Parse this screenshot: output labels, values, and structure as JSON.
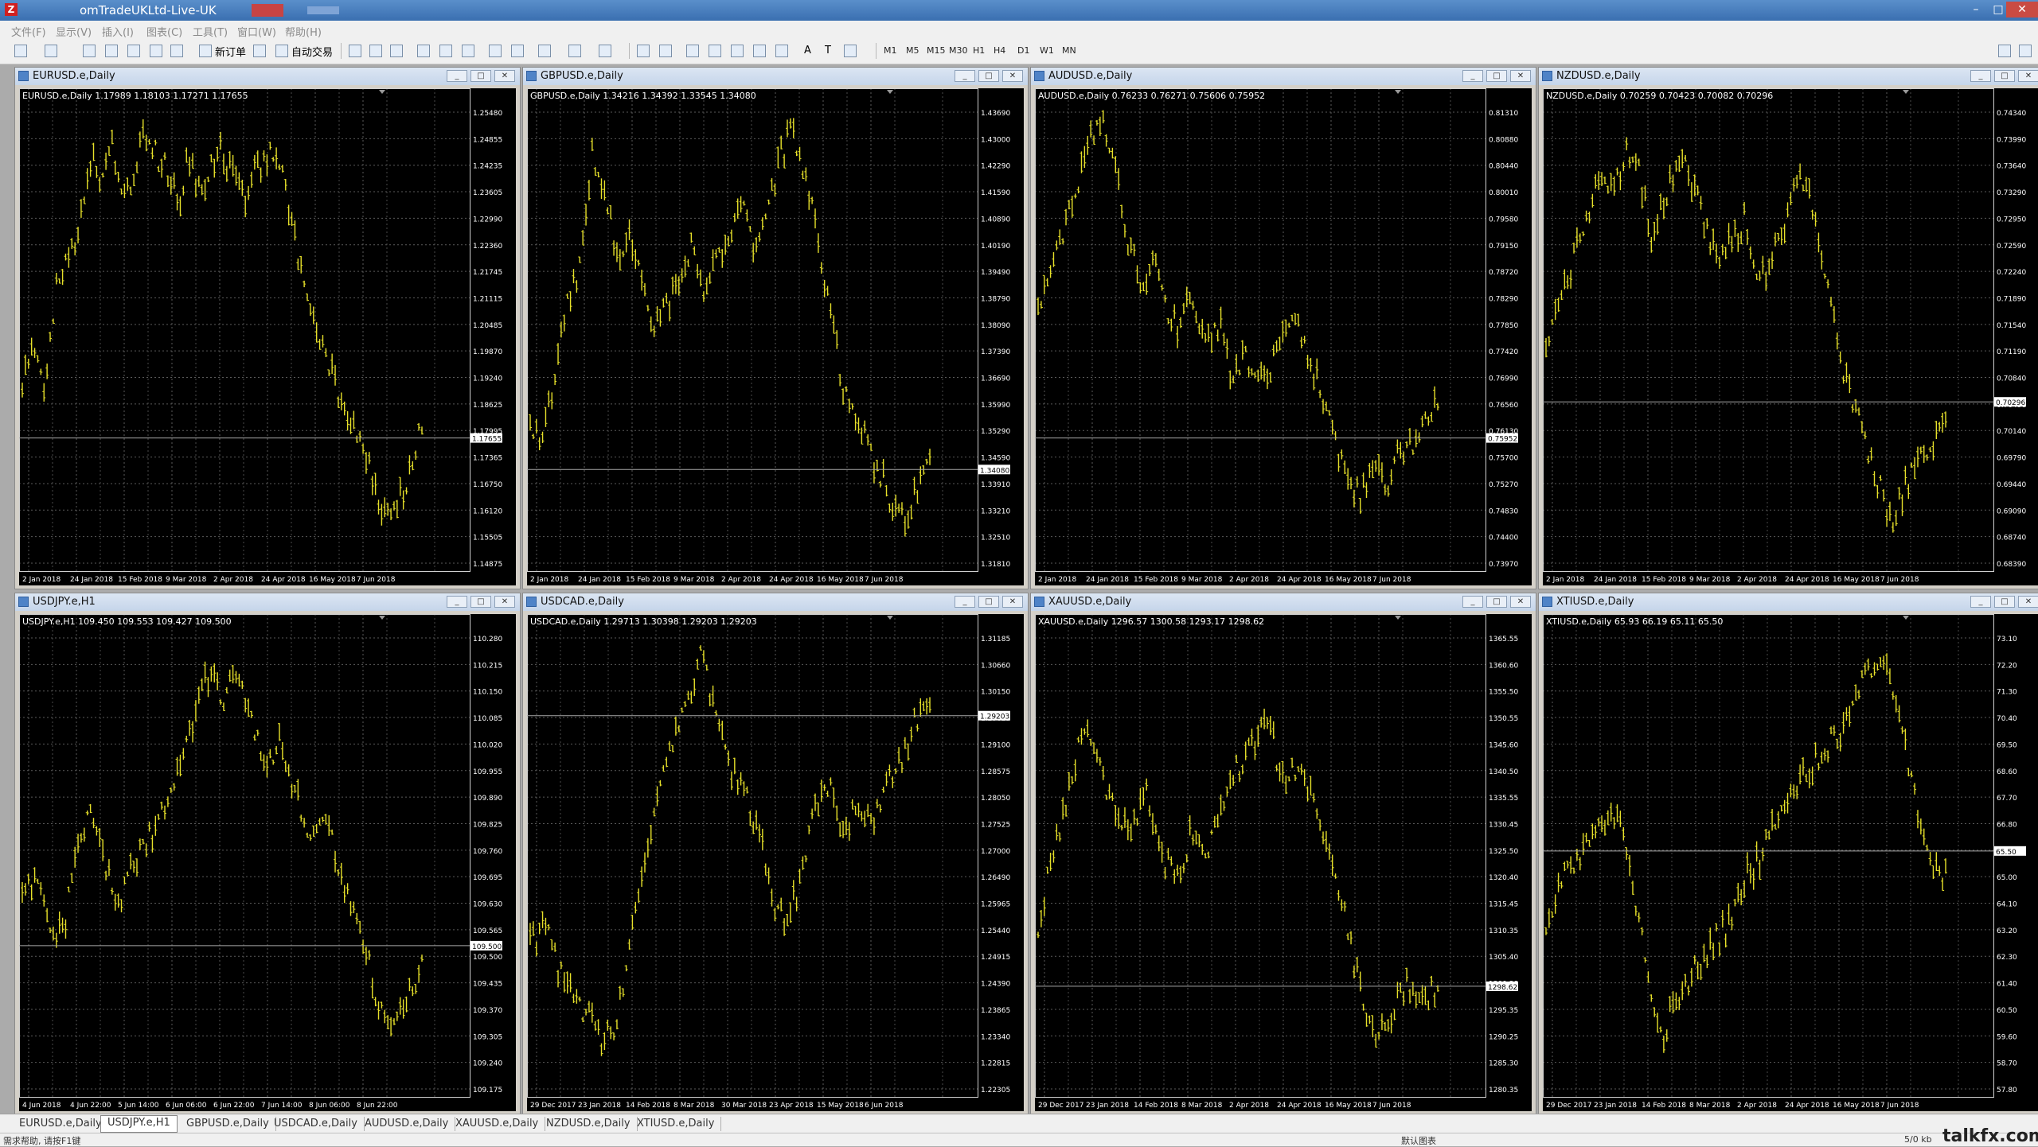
{
  "app": {
    "title": "omTradeUKLtd-Live-UK",
    "logo_letter": "Z"
  },
  "menu": [
    "文件(F)",
    "显示(V)",
    "插入(I)",
    "图表(C)",
    "工具(T)",
    "窗口(W)",
    "帮助(H)"
  ],
  "toolbar": {
    "new_order": "新订单",
    "auto_trade": "自动交易",
    "timeframes": [
      "M1",
      "M5",
      "M15",
      "M30",
      "H1",
      "H4",
      "D1",
      "W1",
      "MN"
    ],
    "text_tool": "A",
    "label_tool": "T"
  },
  "charts": [
    {
      "title": "EURUSD.e,Daily",
      "legend": "EURUSD.e,Daily  1.17989 1.18103 1.17271 1.17655",
      "current": "1.17655",
      "yticks": [
        "1.25480",
        "1.24855",
        "1.24235",
        "1.23605",
        "1.22990",
        "1.22360",
        "1.21745",
        "1.21115",
        "1.20485",
        "1.19870",
        "1.19240",
        "1.18625",
        "1.17995",
        "1.17365",
        "1.16750",
        "1.16120",
        "1.15505",
        "1.14875"
      ],
      "xticks": [
        "2 Jan 2018",
        "24 Jan 2018",
        "15 Feb 2018",
        "9 Mar 2018",
        "2 Apr 2018",
        "24 Apr 2018",
        "16 May 2018",
        "7 Jun 2018"
      ],
      "path": [
        0.62,
        0.55,
        0.65,
        0.4,
        0.35,
        0.28,
        0.12,
        0.15,
        0.08,
        0.2,
        0.18,
        0.05,
        0.1,
        0.15,
        0.22,
        0.12,
        0.18,
        0.14,
        0.1,
        0.16,
        0.22,
        0.14,
        0.12,
        0.1,
        0.25,
        0.35,
        0.45,
        0.55,
        0.6,
        0.68,
        0.72,
        0.78,
        0.86,
        0.92,
        0.88,
        0.8,
        0.72
      ],
      "curFrac": 0.74
    },
    {
      "title": "GBPUSD.e,Daily",
      "legend": "GBPUSD.e,Daily  1.34216 1.34392 1.33545 1.34080",
      "current": "1.34080",
      "yticks": [
        "1.43690",
        "1.43000",
        "1.42290",
        "1.41590",
        "1.40890",
        "1.40190",
        "1.39490",
        "1.38790",
        "1.38090",
        "1.37390",
        "1.36690",
        "1.35990",
        "1.35290",
        "1.34590",
        "1.33910",
        "1.33210",
        "1.32510",
        "1.31810"
      ],
      "xticks": [
        "2 Jan 2018",
        "24 Jan 2018",
        "15 Feb 2018",
        "9 Mar 2018",
        "2 Apr 2018",
        "24 Apr 2018",
        "16 May 2018",
        "7 Jun 2018"
      ],
      "path": [
        0.7,
        0.75,
        0.6,
        0.45,
        0.35,
        0.1,
        0.2,
        0.35,
        0.3,
        0.4,
        0.5,
        0.45,
        0.38,
        0.3,
        0.42,
        0.35,
        0.28,
        0.18,
        0.32,
        0.22,
        0.12,
        0.05,
        0.15,
        0.3,
        0.45,
        0.62,
        0.68,
        0.75,
        0.82,
        0.88,
        0.92,
        0.85,
        0.8
      ],
      "curFrac": 0.81
    },
    {
      "title": "AUDUSD.e,Daily",
      "legend": "AUDUSD.e,Daily  0.76233 0.76271 0.75606 0.75952",
      "current": "0.75952",
      "yticks": [
        "0.81310",
        "0.80880",
        "0.80440",
        "0.80010",
        "0.79580",
        "0.79150",
        "0.78720",
        "0.78290",
        "0.77850",
        "0.77420",
        "0.76990",
        "0.76560",
        "0.76130",
        "0.75700",
        "0.75270",
        "0.74830",
        "0.74400",
        "0.73970"
      ],
      "xticks": [
        "2 Jan 2018",
        "24 Jan 2018",
        "15 Feb 2018",
        "9 Mar 2018",
        "2 Apr 2018",
        "24 Apr 2018",
        "16 May 2018",
        "7 Jun 2018"
      ],
      "path": [
        0.45,
        0.38,
        0.28,
        0.2,
        0.08,
        0.05,
        0.15,
        0.3,
        0.4,
        0.35,
        0.45,
        0.5,
        0.42,
        0.55,
        0.48,
        0.6,
        0.55,
        0.62,
        0.58,
        0.52,
        0.48,
        0.55,
        0.65,
        0.75,
        0.82,
        0.88,
        0.8,
        0.85,
        0.78,
        0.75,
        0.7,
        0.65
      ],
      "curFrac": 0.74
    },
    {
      "title": "NZDUSD.e,Daily",
      "legend": "NZDUSD.e,Daily  0.70259 0.70423 0.70082 0.70296",
      "current": "0.70296",
      "yticks": [
        "0.74340",
        "0.73990",
        "0.73640",
        "0.73290",
        "0.72950",
        "0.72590",
        "0.72240",
        "0.71890",
        "0.71540",
        "0.71190",
        "0.70840",
        "0.70490",
        "0.70140",
        "0.69790",
        "0.69440",
        "0.69090",
        "0.68740",
        "0.68390"
      ],
      "xticks": [
        "2 Jan 2018",
        "24 Jan 2018",
        "15 Feb 2018",
        "9 Mar 2018",
        "2 Apr 2018",
        "24 Apr 2018",
        "16 May 2018",
        "7 Jun 2018"
      ],
      "path": [
        0.55,
        0.45,
        0.35,
        0.25,
        0.15,
        0.2,
        0.1,
        0.15,
        0.3,
        0.2,
        0.12,
        0.18,
        0.28,
        0.35,
        0.3,
        0.25,
        0.4,
        0.35,
        0.25,
        0.15,
        0.22,
        0.4,
        0.55,
        0.65,
        0.75,
        0.85,
        0.92,
        0.85,
        0.8,
        0.75,
        0.7
      ],
      "curFrac": 0.66
    },
    {
      "title": "USDJPY.e,H1",
      "legend": "USDJPY.e,H1  109.450 109.553 109.427 109.500",
      "current": "109.500",
      "yticks": [
        "110.280",
        "110.215",
        "110.150",
        "110.085",
        "110.020",
        "109.955",
        "109.890",
        "109.825",
        "109.760",
        "109.695",
        "109.630",
        "109.565",
        "109.500",
        "109.435",
        "109.370",
        "109.305",
        "109.240",
        "109.175"
      ],
      "xticks": [
        "4 Jun 2018",
        "4 Jun 22:00",
        "5 Jun 14:00",
        "6 Jun 06:00",
        "6 Jun 22:00",
        "7 Jun 14:00",
        "8 Jun 06:00",
        "8 Jun 22:00"
      ],
      "path": [
        0.6,
        0.55,
        0.7,
        0.65,
        0.45,
        0.4,
        0.55,
        0.6,
        0.5,
        0.45,
        0.4,
        0.3,
        0.2,
        0.1,
        0.15,
        0.08,
        0.2,
        0.3,
        0.25,
        0.35,
        0.45,
        0.4,
        0.5,
        0.6,
        0.7,
        0.85,
        0.9,
        0.8,
        0.75
      ],
      "curFrac": 0.7
    },
    {
      "title": "USDCAD.e,Daily",
      "legend": "USDCAD.e,Daily  1.29713 1.30398 1.29203 1.29203",
      "current": "1.29203",
      "yticks": [
        "1.31185",
        "1.30660",
        "1.30150",
        "1.29625",
        "1.29100",
        "1.28575",
        "1.28050",
        "1.27525",
        "1.27000",
        "1.26490",
        "1.25965",
        "1.25440",
        "1.24915",
        "1.24390",
        "1.23865",
        "1.23340",
        "1.22815",
        "1.22305"
      ],
      "xticks": [
        "29 Dec 2017",
        "23 Jan 2018",
        "14 Feb 2018",
        "8 Mar 2018",
        "30 Mar 2018",
        "23 Apr 2018",
        "15 May 2018",
        "6 Jun 2018"
      ],
      "path": [
        0.7,
        0.65,
        0.75,
        0.8,
        0.85,
        0.92,
        0.88,
        0.7,
        0.5,
        0.35,
        0.25,
        0.15,
        0.05,
        0.2,
        0.3,
        0.35,
        0.45,
        0.6,
        0.65,
        0.55,
        0.4,
        0.35,
        0.45,
        0.38,
        0.42,
        0.35,
        0.28,
        0.2,
        0.15
      ],
      "curFrac": 0.19
    },
    {
      "title": "XAUUSD.e,Daily",
      "legend": "XAUUSD.e,Daily  1296.57 1300.58 1293.17 1298.62",
      "current": "1298.62",
      "yticks": [
        "1365.55",
        "1360.60",
        "1355.50",
        "1350.55",
        "1345.60",
        "1340.50",
        "1335.55",
        "1330.45",
        "1325.50",
        "1320.40",
        "1315.45",
        "1310.35",
        "1305.40",
        "1300.30",
        "1295.35",
        "1290.25",
        "1285.30",
        "1280.35"
      ],
      "xticks": [
        "29 Dec 2017",
        "23 Jan 2018",
        "14 Feb 2018",
        "8 Mar 2018",
        "2 Apr 2018",
        "24 Apr 2018",
        "16 May 2018",
        "7 Jun 2018"
      ],
      "path": [
        0.65,
        0.5,
        0.35,
        0.2,
        0.3,
        0.4,
        0.45,
        0.35,
        0.5,
        0.55,
        0.45,
        0.5,
        0.4,
        0.3,
        0.25,
        0.2,
        0.35,
        0.3,
        0.4,
        0.5,
        0.65,
        0.8,
        0.92,
        0.85,
        0.78,
        0.82,
        0.8
      ],
      "curFrac": 0.79
    },
    {
      "title": "XTIUSD.e,Daily",
      "legend": "XTIUSD.e,Daily  65.93 66.19 65.11 65.50",
      "current": "65.50",
      "yticks": [
        "73.10",
        "72.20",
        "71.30",
        "70.40",
        "69.50",
        "68.60",
        "67.70",
        "66.80",
        "65.90",
        "65.00",
        "64.10",
        "63.20",
        "62.30",
        "61.40",
        "60.50",
        "59.60",
        "58.70",
        "57.80"
      ],
      "xticks": [
        "29 Dec 2017",
        "23 Jan 2018",
        "14 Feb 2018",
        "8 Mar 2018",
        "2 Apr 2018",
        "24 Apr 2018",
        "16 May 2018",
        "7 Jun 2018"
      ],
      "path": [
        0.65,
        0.55,
        0.5,
        0.45,
        0.4,
        0.5,
        0.75,
        0.9,
        0.8,
        0.75,
        0.7,
        0.65,
        0.55,
        0.5,
        0.4,
        0.35,
        0.3,
        0.25,
        0.22,
        0.1,
        0.05,
        0.15,
        0.35,
        0.5,
        0.55
      ],
      "curFrac": 0.49
    }
  ],
  "tabs": [
    "EURUSD.e,Daily",
    "USDJPY.e,H1",
    "GBPUSD.e,Daily",
    "USDCAD.e,Daily",
    "AUDUSD.e,Daily",
    "XAUUSD.e,Daily",
    "NZDUSD.e,Daily",
    "XTIUSD.e,Daily"
  ],
  "active_tab": 1,
  "status": {
    "left": "需求帮助, 请按F1键",
    "mid": "默认图表",
    "right_conn": "5/0 kb"
  },
  "watermark": "talkfx.com"
}
